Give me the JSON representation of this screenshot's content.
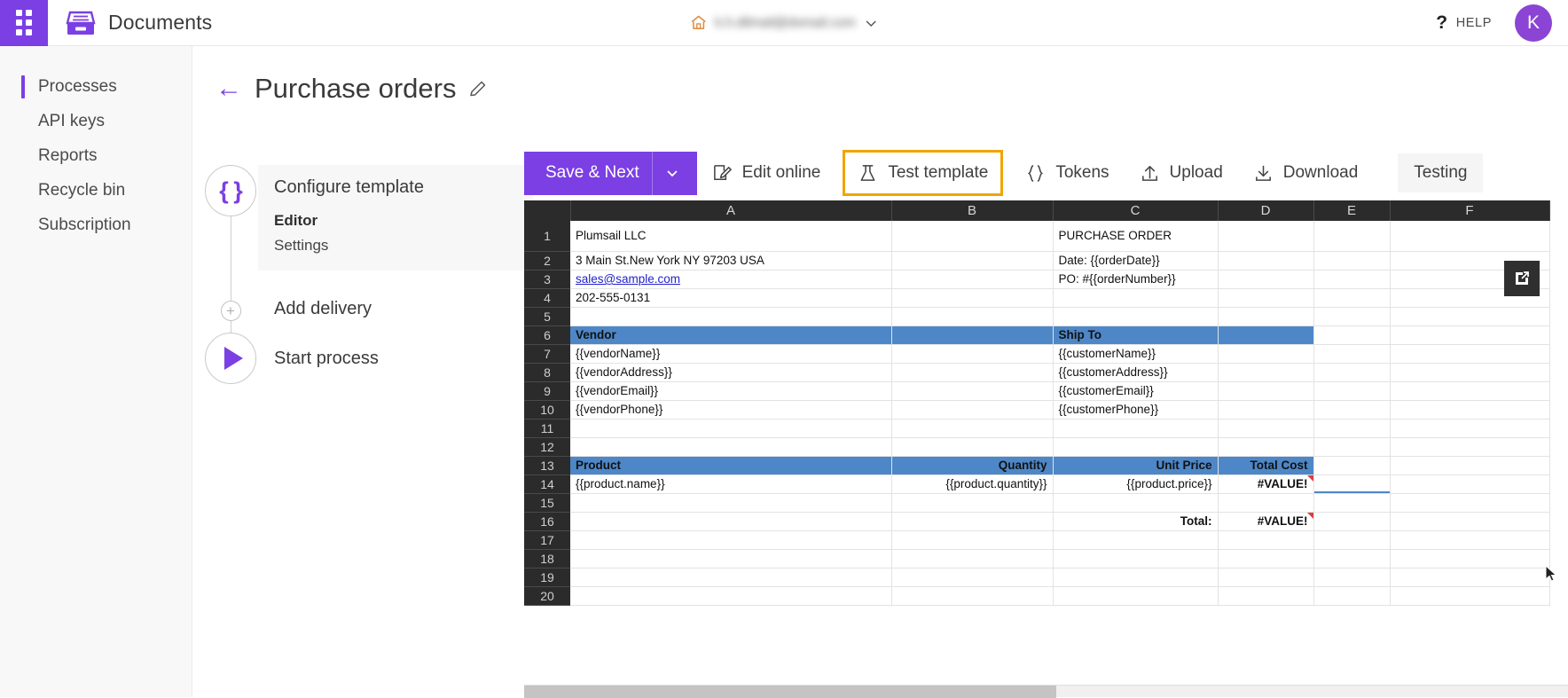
{
  "topbar": {
    "waffle_icon": "app-launcher-icon",
    "brand_icon": "documents-box-icon",
    "brand_title": "Documents",
    "home_icon": "home-icon",
    "tenant_email": "k.h.dilmail@domail.com",
    "chevron_icon": "chevron-down-icon",
    "help_label": "HELP",
    "help_icon": "question-mark-icon",
    "avatar_initial": "K",
    "accent_purple": "#7b3fe4"
  },
  "sidebar": {
    "items": [
      {
        "label": "Processes",
        "active": true
      },
      {
        "label": "API keys",
        "active": false
      },
      {
        "label": "Reports",
        "active": false
      },
      {
        "label": "Recycle bin",
        "active": false
      },
      {
        "label": "Subscription",
        "active": false
      }
    ]
  },
  "page": {
    "back_icon": "back-arrow-icon",
    "title": "Purchase orders",
    "edit_icon": "pencil-icon"
  },
  "stepper": {
    "steps": [
      {
        "title": "Configure template",
        "icon": "curly-braces-icon",
        "sub_items": [
          {
            "label": "Editor",
            "active": true
          },
          {
            "label": "Settings",
            "active": false
          }
        ]
      },
      {
        "title": "Add delivery",
        "icon": "plus-icon",
        "sub_items": []
      },
      {
        "title": "Start process",
        "icon": "play-icon",
        "sub_items": []
      }
    ]
  },
  "toolbar": {
    "save_next_label": "Save & Next",
    "save_next_chevron": "chevron-down-icon",
    "buttons": [
      {
        "label": "Edit online",
        "icon": "edit-online-icon",
        "highlighted": false
      },
      {
        "label": "Test template",
        "icon": "flask-icon",
        "highlighted": true
      },
      {
        "label": "Tokens",
        "icon": "curly-braces-icon",
        "highlighted": false
      },
      {
        "label": "Upload",
        "icon": "upload-arrow-icon",
        "highlighted": false
      },
      {
        "label": "Download",
        "icon": "download-arrow-icon",
        "highlighted": false
      }
    ],
    "testing_tab_label": "Testing",
    "highlight_color": "#f0a500"
  },
  "spreadsheet": {
    "popout_icon": "open-external-icon",
    "columns": [
      "A",
      "B",
      "C",
      "D",
      "E",
      "F"
    ],
    "rows": [
      {
        "n": "1",
        "A": "Plumsail LLC",
        "B": "",
        "C": "PURCHASE ORDER",
        "D": "",
        "E": "",
        "F": ""
      },
      {
        "n": "2",
        "A": "3 Main St.New York NY 97203 USA",
        "B": "",
        "C": "Date: {{orderDate}}",
        "D": "",
        "E": "",
        "F": ""
      },
      {
        "n": "3",
        "A": "sales@sample.com",
        "B": "",
        "C": "PO: #{{orderNumber}}",
        "D": "",
        "E": "",
        "F": ""
      },
      {
        "n": "4",
        "A": "202-555-0131",
        "B": "",
        "C": "",
        "D": "",
        "E": "",
        "F": ""
      },
      {
        "n": "5",
        "A": "",
        "B": "",
        "C": "",
        "D": "",
        "E": "",
        "F": ""
      },
      {
        "n": "6",
        "A": "Vendor",
        "B": "",
        "C": "Ship To",
        "D": "",
        "E": "",
        "F": ""
      },
      {
        "n": "7",
        "A": "{{vendorName}}",
        "B": "",
        "C": "{{customerName}}",
        "D": "",
        "E": "",
        "F": ""
      },
      {
        "n": "8",
        "A": "{{vendorAddress}}",
        "B": "",
        "C": "{{customerAddress}}",
        "D": "",
        "E": "",
        "F": ""
      },
      {
        "n": "9",
        "A": "{{vendorEmail}}",
        "B": "",
        "C": "{{customerEmail}}",
        "D": "",
        "E": "",
        "F": ""
      },
      {
        "n": "10",
        "A": "{{vendorPhone}}",
        "B": "",
        "C": "{{customerPhone}}",
        "D": "",
        "E": "",
        "F": ""
      },
      {
        "n": "11",
        "A": "",
        "B": "",
        "C": "",
        "D": "",
        "E": "",
        "F": ""
      },
      {
        "n": "12",
        "A": "",
        "B": "",
        "C": "",
        "D": "",
        "E": "",
        "F": ""
      },
      {
        "n": "13",
        "A": "Product",
        "B": "Quantity",
        "C": "Unit Price",
        "D": "Total Cost",
        "E": "",
        "F": ""
      },
      {
        "n": "14",
        "A": "{{product.name}}",
        "B": "{{product.quantity}}",
        "C": "{{product.price}}",
        "D": "#VALUE!",
        "E": "",
        "F": ""
      },
      {
        "n": "15",
        "A": "",
        "B": "",
        "C": "",
        "D": "",
        "E": "",
        "F": ""
      },
      {
        "n": "16",
        "A": "",
        "B": "",
        "C": "Total:",
        "D": "#VALUE!",
        "E": "",
        "F": ""
      },
      {
        "n": "17",
        "A": "",
        "B": "",
        "C": "",
        "D": "",
        "E": "",
        "F": ""
      },
      {
        "n": "18",
        "A": "",
        "B": "",
        "C": "",
        "D": "",
        "E": "",
        "F": ""
      },
      {
        "n": "19",
        "A": "",
        "B": "",
        "C": "",
        "D": "",
        "E": "",
        "F": ""
      },
      {
        "n": "20",
        "A": "",
        "B": "",
        "C": "",
        "D": "",
        "E": "",
        "F": ""
      }
    ],
    "band_color": "#4e87c7",
    "po_title_color": "#5b9bd5"
  }
}
